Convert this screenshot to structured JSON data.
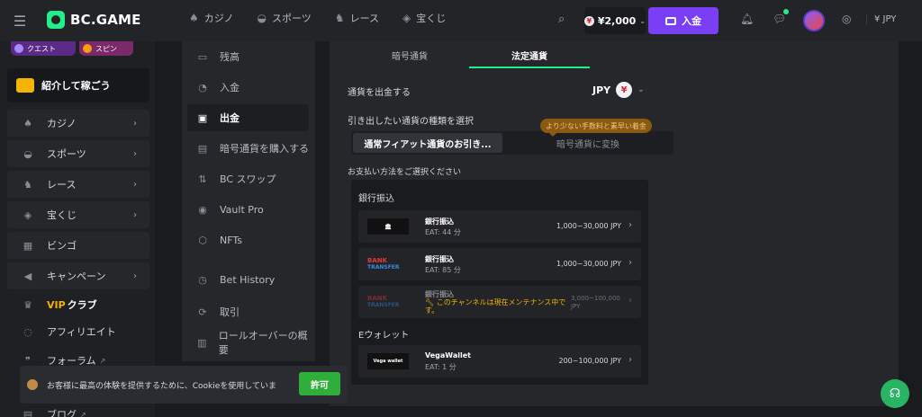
{
  "header": {
    "brand": "BC.GAME",
    "nav": [
      {
        "label": "カジノ",
        "icon": "casino-icon"
      },
      {
        "label": "スポーツ",
        "icon": "sports-icon"
      },
      {
        "label": "レース",
        "icon": "race-icon"
      },
      {
        "label": "宝くじ",
        "icon": "lottery-icon"
      }
    ],
    "balance": "¥2,000",
    "deposit_label": "入金",
    "currency": "¥ JPY"
  },
  "sidebar": {
    "promos": [
      "クエスト",
      "スピン"
    ],
    "refer_label": "紹介して稼ごう",
    "items": [
      {
        "label": "カジノ"
      },
      {
        "label": "スポーツ"
      },
      {
        "label": "レース"
      },
      {
        "label": "宝くじ"
      },
      {
        "label": "ビンゴ"
      },
      {
        "label": "キャンペーン"
      },
      {
        "label_vip": "VIP",
        "label_rest": "クラブ"
      },
      {
        "label": "アフィリエイト"
      },
      {
        "label": "フォーラム"
      },
      {
        "label": "ブログ"
      }
    ]
  },
  "account_menu": [
    {
      "label": "残高"
    },
    {
      "label": "入金"
    },
    {
      "label": "出金"
    },
    {
      "label": "暗号通貨を購入する"
    },
    {
      "label": "BC スワップ"
    },
    {
      "label": "Vault Pro"
    },
    {
      "label": "NFTs"
    },
    {
      "label": "Bet History"
    },
    {
      "label": "取引"
    },
    {
      "label": "ロールオーバーの概要"
    }
  ],
  "withdraw": {
    "tabs": [
      "暗号通貨",
      "法定通貨"
    ],
    "currency_label": "通貨を出金する",
    "currency_value": "JPY",
    "type_label": "引き出したい通貨の種類を選択",
    "tooltip": "より少ない手数料と素早い着金",
    "option_fiat": "通常フィアット通貨のお引き...",
    "option_crypto": "暗号通貨に変換",
    "method_label": "お支払い方法をご選択ください",
    "groups": {
      "bank_title": "銀行振込",
      "ewallet_title": "Eウォレット"
    },
    "methods": [
      {
        "name": "銀行振込",
        "eat": "EAT: 44 分",
        "range": "1,000~30,000 JPY"
      },
      {
        "name": "銀行振込",
        "eat": "EAT: 85 分",
        "range": "1,000~30,000 JPY",
        "logo1": "BANK",
        "logo2": "TRANSFER"
      },
      {
        "name": "銀行振込",
        "maintenance": "このチャンネルは現在メンテナンス中です。",
        "range": "3,000~100,000 JPY",
        "logo1": "BANK",
        "logo2": "TRANSFER"
      },
      {
        "name": "VegaWallet",
        "eat": "EAT: 1 分",
        "range": "200~100,000 JPY",
        "logo": "Vega wallet"
      }
    ]
  },
  "cookie": {
    "text": "お客様に最高の体験を提供するために、Cookieを使用していま",
    "accept": "許可"
  },
  "colors": {
    "accent": "#24ee89",
    "deposit": "#7a3ff5",
    "cookie_button": "#2fae3b"
  }
}
